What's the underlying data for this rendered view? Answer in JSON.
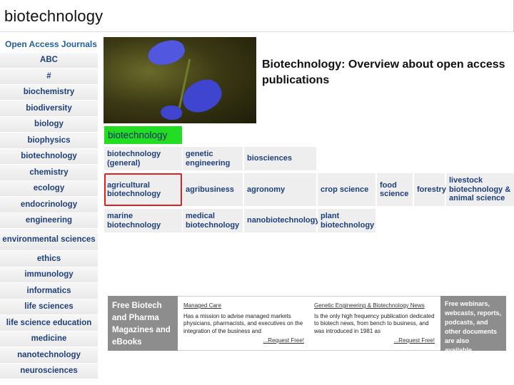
{
  "page": {
    "title": "biotechnology"
  },
  "sidebar": {
    "header": "Open Access Journals",
    "items": [
      "ABC",
      "#",
      "biochemistry",
      "biodiversity",
      "biology",
      "biophysics",
      "biotechnology",
      "chemistry",
      "ecology",
      "endocrinology",
      "engineering",
      "environmental sciences",
      "ethics",
      "immunology",
      "informatics",
      "life sciences",
      "life science education",
      "medicine",
      "nanotechnology",
      "neurosciences"
    ]
  },
  "main": {
    "headline": "Biotechnology: Overview about open access publications",
    "section_label": "biotechnology",
    "categories": [
      "biotechnology (general)",
      "genetic engineering",
      "biosciences",
      "agricultural biotechnology",
      "agribusiness",
      "agronomy",
      "crop science",
      "food science",
      "forestry",
      "livestock biotechnology & animal science",
      "marine biotechnology",
      "medical biotechnology",
      "nanobiotechnology",
      "plant biotechnology"
    ]
  },
  "banner": {
    "left": "Free Biotech and Pharma Magazines and eBooks",
    "col1": {
      "title": "Managed Care",
      "body": "Has a mission to advise managed markets physicians, pharmacists, and executives on the integration of the business and",
      "link": "...Request Free!"
    },
    "col2": {
      "title": "Genetic Engineering & Biotechnology News",
      "body": "Is the only high frequency publication dedicated to biotech news, from bench to business, and was introduced in 1981 as",
      "link": "...Request Free!"
    },
    "right": "Free webinars, webcasts, reports, podcasts, and other documents are also available..."
  }
}
